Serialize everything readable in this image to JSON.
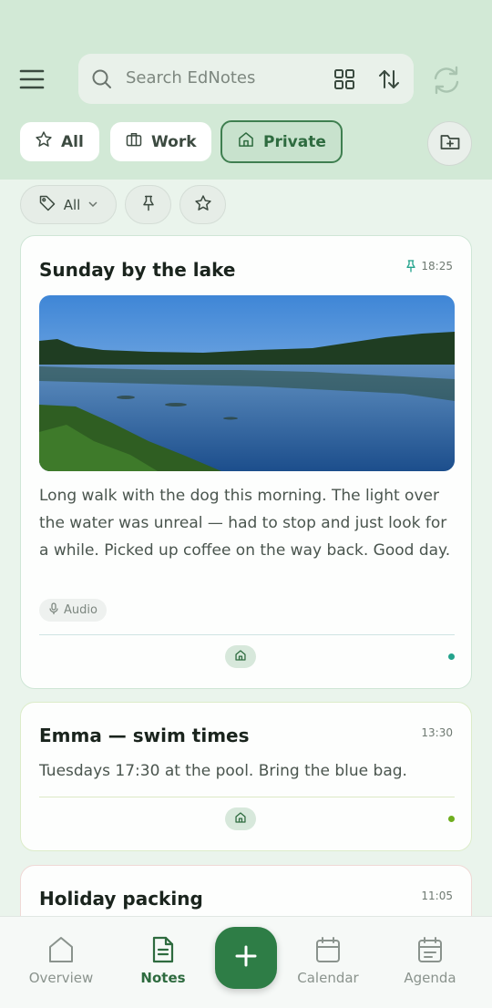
{
  "search": {
    "placeholder": "Search EdNotes"
  },
  "categories": [
    {
      "label": "All",
      "icon": "star-icon"
    },
    {
      "label": "Work",
      "icon": "briefcase-icon"
    },
    {
      "label": "Private",
      "icon": "home-icon",
      "selected": true
    }
  ],
  "filters": {
    "tags_label": "All"
  },
  "notes": [
    {
      "title": "Sunday by the lake",
      "time": "18:25",
      "pinned": true,
      "body": "Long walk with the dog this morning. The light over the water was unreal — had to stop and just look for a while. Picked up coffee on the way back. Good day.",
      "attachment": "Audio",
      "color": "#23a38c"
    },
    {
      "title": "Emma — swim times",
      "time": "13:30",
      "body": "Tuesdays 17:30 at the pool. Bring the blue bag.",
      "color": "#6fae1e"
    },
    {
      "title": "Holiday packing",
      "time": "11:05"
    }
  ],
  "nav": {
    "overview": "Overview",
    "notes": "Notes",
    "calendar": "Calendar",
    "agenda": "Agenda"
  },
  "colors": {
    "accent": "#2e7d46",
    "header_bg": "#d2e9d6"
  }
}
